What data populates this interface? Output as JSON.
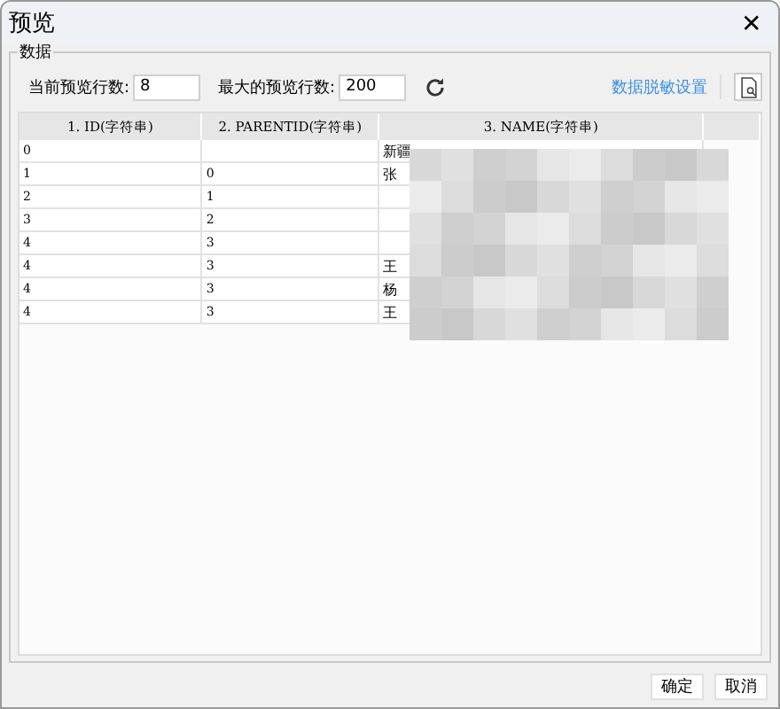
{
  "window": {
    "title": "预览",
    "close": "✕"
  },
  "group": {
    "label": "数据"
  },
  "toolbar": {
    "current_rows_label": "当前预览行数:",
    "current_rows": "8",
    "max_rows_label": "最大的预览行数:",
    "max_rows": "200",
    "mask_link": "数据脱敏设置"
  },
  "table": {
    "columns": [
      "1. ID(字符串)",
      "2. PARENTID(字符串)",
      "3. NAME(字符串)"
    ],
    "rows": [
      [
        "0",
        "",
        "新疆"
      ],
      [
        "1",
        "0",
        "张"
      ],
      [
        "2",
        "1",
        ""
      ],
      [
        "3",
        "2",
        ""
      ],
      [
        "4",
        "3",
        ""
      ],
      [
        "4",
        "3",
        "王"
      ],
      [
        "4",
        "3",
        "杨"
      ],
      [
        "4",
        "3",
        "王"
      ]
    ]
  },
  "buttons": [
    "确定",
    "取消"
  ]
}
